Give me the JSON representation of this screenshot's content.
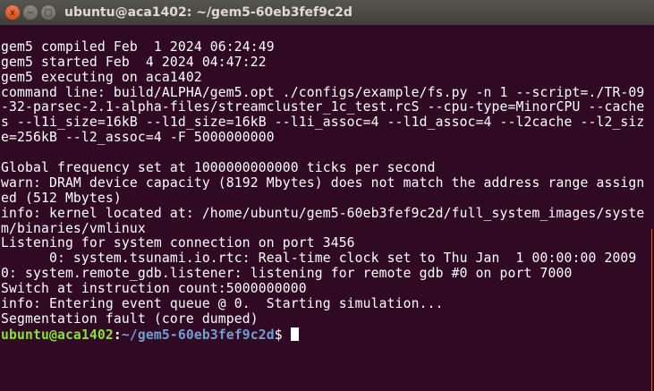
{
  "window": {
    "title": "ubuntu@aca1402: ~/gem5-60eb3fef9c2d",
    "close_label": "x",
    "minimize_label": "−",
    "maximize_label": "□"
  },
  "terminal": {
    "lines": [
      "",
      "gem5 compiled Feb  1 2024 06:24:49",
      "gem5 started Feb  4 2024 04:47:22",
      "gem5 executing on aca1402",
      "command line: build/ALPHA/gem5.opt ./configs/example/fs.py -n 1 --script=./TR-09",
      "-32-parsec-2.1-alpha-files/streamcluster_1c_test.rcS --cpu-type=MinorCPU --cache",
      "s --l1i_size=16kB --l1d_size=16kB --l1i_assoc=4 --l1d_assoc=4 --l2cache --l2_siz",
      "e=256kB --l2_assoc=4 -F 5000000000",
      "",
      "Global frequency set at 1000000000000 ticks per second",
      "warn: DRAM device capacity (8192 Mbytes) does not match the address range assign",
      "ed (512 Mbytes)",
      "info: kernel located at: /home/ubuntu/gem5-60eb3fef9c2d/full_system_images/syste",
      "m/binaries/vmlinux",
      "Listening for system connection on port 3456",
      "      0: system.tsunami.io.rtc: Real-time clock set to Thu Jan  1 00:00:00 2009",
      "0: system.remote_gdb.listener: listening for remote gdb #0 on port 7000",
      "Switch at instruction count:5000000000",
      "info: Entering event queue @ 0.  Starting simulation...",
      "Segmentation fault (core dumped)"
    ],
    "prompt": {
      "user_host": "ubuntu@aca1402",
      "separator": ":",
      "path": "~/gem5-60eb3fef9c2d",
      "symbol": "$"
    }
  },
  "colors": {
    "background": "#300a24",
    "prompt_user": "#8ae234",
    "prompt_path": "#729fcf"
  }
}
